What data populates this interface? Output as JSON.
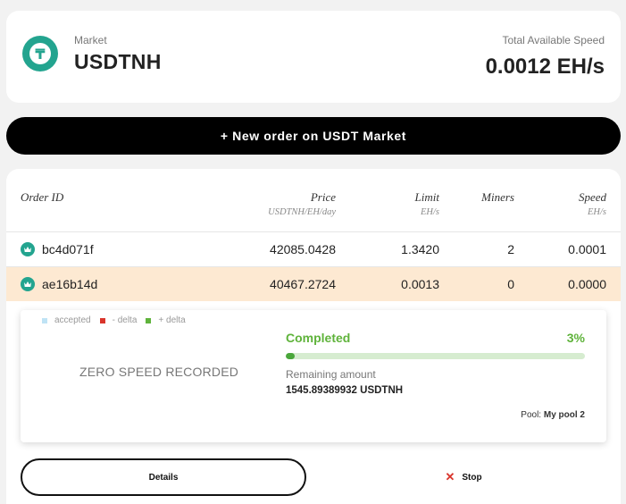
{
  "header": {
    "market_label": "Market",
    "market_name": "USDTNH",
    "speed_label": "Total Available Speed",
    "speed_value": "0.0012 EH/s",
    "logo_glyph": "₸",
    "logo_color": "#23a48f"
  },
  "new_order_label": "+ New order on USDT Market",
  "table": {
    "columns": {
      "order_id": "Order ID",
      "price": "Price",
      "price_unit": "USDTNH/EH/day",
      "limit": "Limit",
      "limit_unit": "EH/s",
      "miners": "Miners",
      "speed": "Speed",
      "speed_unit": "EH/s"
    },
    "rows": [
      {
        "icon": "crown-icon",
        "id": "bc4d071f",
        "price": "42085.0428",
        "limit": "1.3420",
        "miners": "2",
        "speed": "0.0001"
      },
      {
        "icon": "crown-icon",
        "id": "ae16b14d",
        "price": "40467.2724",
        "limit": "0.0013",
        "miners": "0",
        "speed": "0.0000",
        "selected": true
      }
    ]
  },
  "detail": {
    "legend": [
      {
        "label": "accepted",
        "color": "#bfe3f5"
      },
      {
        "label": "- delta",
        "color": "#d9342b"
      },
      {
        "label": "+ delta",
        "color": "#5fb33b"
      }
    ],
    "zero_speed": "ZERO SPEED RECORDED",
    "status": "Completed",
    "percent": "3%",
    "progress": 0.03,
    "remaining_label": "Remaining amount",
    "remaining_value": "1545.89389932 USDTNH",
    "pool_label": "Pool:",
    "pool_name": "My pool 2"
  },
  "actions": {
    "details": "Details",
    "stop": "Stop"
  }
}
